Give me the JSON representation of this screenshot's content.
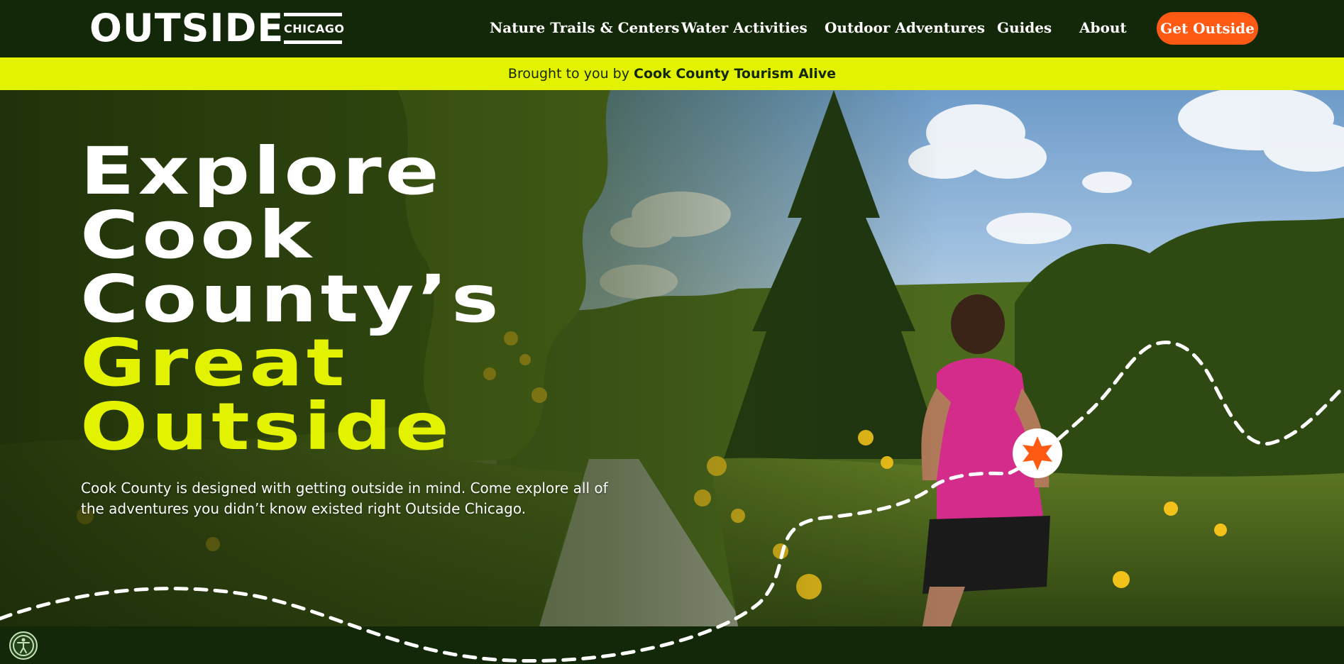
{
  "header": {
    "logo": {
      "main": "OUTSIDE",
      "sub": "CHICAGO"
    },
    "nav": [
      {
        "label": "Nature Trails & Centers"
      },
      {
        "label": "Water Activities"
      },
      {
        "label": "Outdoor Adventures"
      },
      {
        "label": "Guides"
      },
      {
        "label": "About"
      }
    ],
    "cta_label": "Get Outside"
  },
  "banner": {
    "prefix": "Brought to you by",
    "sponsor": "Cook County Tourism Alive"
  },
  "hero": {
    "headline_white": [
      "Explore",
      "Cook",
      "County’s"
    ],
    "headline_yellow": [
      "Great",
      "Outside"
    ],
    "subtext": "Cook County is designed with getting outside in mind. Come explore all of the adventures you didn’t know existed right Outside Chicago."
  },
  "icons": {
    "accessibility": "accessibility-icon",
    "route_marker": "star-icon"
  },
  "colors": {
    "dark_green": "#132808",
    "accent_yellow": "#e3f200",
    "cta_orange": "#ff5a14"
  }
}
